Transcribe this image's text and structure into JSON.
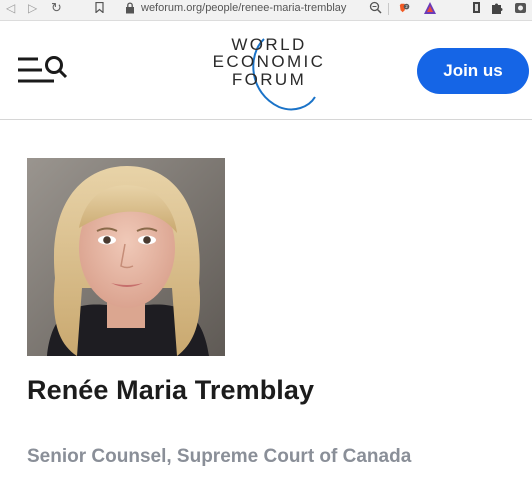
{
  "browser": {
    "url": "weforum.org/people/renee-maria-tremblay",
    "nav_back_icon": "back-arrow-icon",
    "nav_forward_icon": "forward-arrow-icon",
    "reload_icon": "reload-icon",
    "extension_badge": "2"
  },
  "header": {
    "logo": {
      "line1": "WORLD",
      "line2": "ECONOMIC",
      "line3": "FORUM",
      "arc_color": "#1a73c8"
    },
    "menu_icon": "menu-search-icon",
    "join_label": "Join us",
    "join_color": "#1565e6"
  },
  "profile": {
    "name": "Renée Maria Tremblay",
    "title": "Senior Counsel, Supreme Court of Canada"
  }
}
